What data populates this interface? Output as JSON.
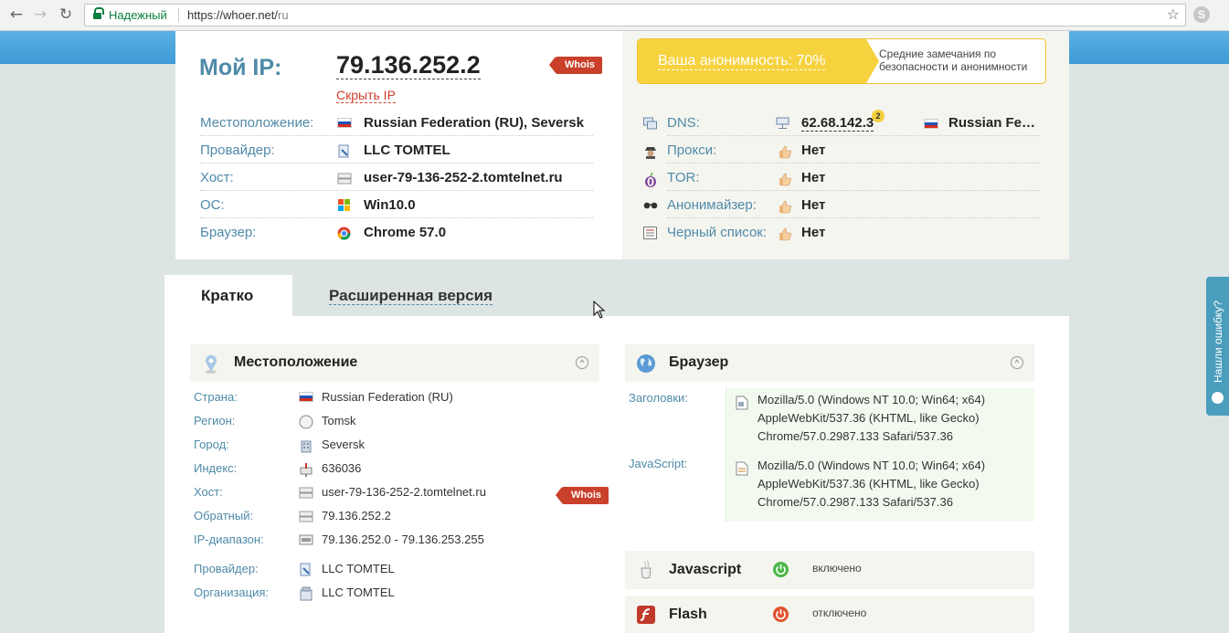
{
  "browser": {
    "secure_label": "Надежный",
    "url_host": "https://whoer.net/",
    "url_path": "ru"
  },
  "top": {
    "my_ip_label": "Мой IP:",
    "ip": "79.136.252.2",
    "hide_ip": "Скрыть IP",
    "whois": "Whois",
    "anonymity": "Ваша анонимность: 70%",
    "anonymity_desc": "Средние замечания по безопасности и анонимности",
    "left_rows": [
      {
        "label": "Местоположение:",
        "value": "Russian Federation (RU), Seversk"
      },
      {
        "label": "Провайдер:",
        "value": "LLC TOMTEL"
      },
      {
        "label": "Хост:",
        "value": "user-79-136-252-2.tomtelnet.ru"
      },
      {
        "label": "ОС:",
        "value": "Win10.0"
      },
      {
        "label": "Браузер:",
        "value": "Chrome 57.0"
      }
    ],
    "dns": {
      "label": "DNS:",
      "value": "62.68.142.3",
      "badge": "2",
      "country": "Russian Federation"
    },
    "right_rows": [
      {
        "label": "Прокси:",
        "value": "Нет"
      },
      {
        "label": "TOR:",
        "value": "Нет"
      },
      {
        "label": "Анонимайзер:",
        "value": "Нет"
      },
      {
        "label": "Черный список:",
        "value": "Нет"
      }
    ]
  },
  "tabs": {
    "brief": "Кратко",
    "extended": "Расширенная версия"
  },
  "location": {
    "title": "Местоположение",
    "collapse": "^",
    "rows": [
      {
        "label": "Страна:",
        "value": "Russian Federation (RU)"
      },
      {
        "label": "Регион:",
        "value": "Tomsk"
      },
      {
        "label": "Город:",
        "value": "Seversk"
      },
      {
        "label": "Индекс:",
        "value": "636036"
      },
      {
        "label": "Хост:",
        "value": "user-79-136-252-2.tomtelnet.ru"
      },
      {
        "label": "Обратный:",
        "value": "79.136.252.2"
      },
      {
        "label": "IP-диапазон:",
        "value": "79.136.252.0 - 79.136.253.255"
      },
      {
        "label": "Провайдер:",
        "value": "LLC TOMTEL"
      },
      {
        "label": "Организация:",
        "value": "LLC TOMTEL"
      }
    ],
    "whois": "Whois"
  },
  "browser_section": {
    "title": "Браузер",
    "collapse": "^",
    "headers_label": "Заголовки:",
    "headers_ua": [
      "Mozilla/5.0 (Windows NT 10.0; Win64; x64)",
      "AppleWebKit/537.36 (KHTML, like Gecko)",
      "Chrome/57.0.2987.133 Safari/537.36"
    ],
    "js_label": "JavaScript:",
    "js_ua": [
      "Mozilla/5.0 (Windows NT 10.0; Win64; x64)",
      "AppleWebKit/537.36 (KHTML, like Gecko)",
      "Chrome/57.0.2987.133 Safari/537.36"
    ]
  },
  "features": [
    {
      "title": "Javascript",
      "status": "включено",
      "state": "on",
      "color": "#4cb848"
    },
    {
      "title": "Flash",
      "status": "отключено",
      "state": "off",
      "color": "#e0532d"
    }
  ],
  "feedback": {
    "label": "Нашли ошибку?"
  }
}
